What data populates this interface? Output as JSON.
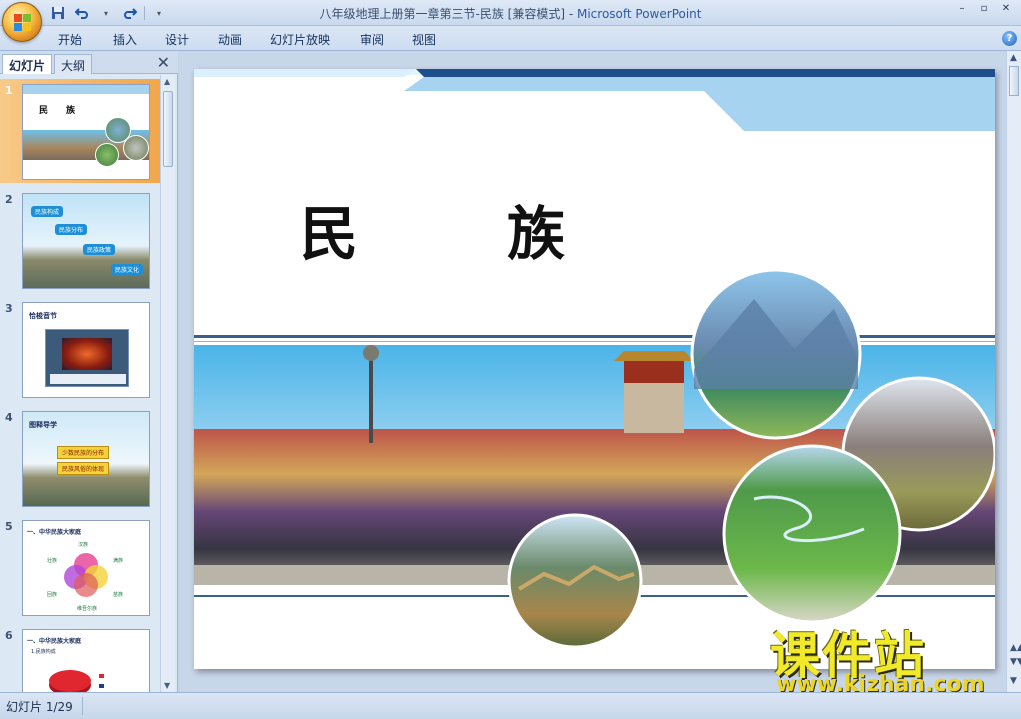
{
  "window": {
    "title": "八年级地理上册第一章第三节-民族 [兼容模式] - ",
    "app_name": "Microsoft PowerPoint",
    "controls": [
      "–",
      "▫",
      "✕"
    ]
  },
  "ribbon": {
    "tabs": [
      "开始",
      "插入",
      "设计",
      "动画",
      "幻灯片放映",
      "审阅",
      "视图"
    ],
    "help": "?"
  },
  "panel": {
    "tabs": [
      "幻灯片",
      "大纲"
    ],
    "close": "✕",
    "thumbnails": [
      {
        "num": "1",
        "title": "民　　族"
      },
      {
        "num": "2",
        "lines": [
          "民族构成",
          "民族分布",
          "民族政策",
          "民族文化"
        ]
      },
      {
        "num": "3",
        "title": "恰梭音节"
      },
      {
        "num": "4",
        "title": "图释导学",
        "lines": [
          "少数民族的分布",
          "民族风俗的体现"
        ]
      },
      {
        "num": "5",
        "title": "一、中华民族大家庭",
        "lines": [
          "汉族",
          "壮族",
          "满族",
          "回族",
          "苗族",
          "维吾尔族"
        ]
      },
      {
        "num": "6",
        "title": "一、中华民族大家庭",
        "lines": [
          "1.民族构成"
        ]
      }
    ]
  },
  "slide": {
    "title_left": "民",
    "title_right": "族"
  },
  "status": {
    "slide_counter": "幻灯片 1/29"
  },
  "watermark": {
    "brand": "课件站",
    "url": "www.kjzhan.com"
  },
  "colors": {
    "accent_blue": "#1f4e8c",
    "sky": "#9bcdee",
    "selection": "#f2a64c"
  }
}
